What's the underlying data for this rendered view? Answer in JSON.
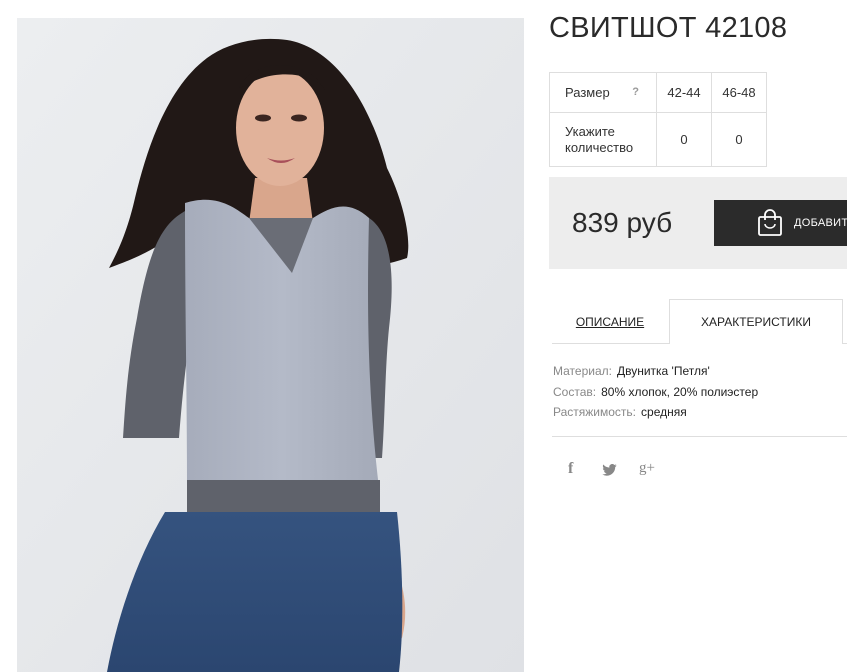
{
  "product": {
    "title": "СВИТШОТ 42108"
  },
  "size_table": {
    "size_label": "Размер",
    "help_mark": "?",
    "sizes": [
      "42-44",
      "46-48"
    ],
    "quantity_label": "Укажите количество",
    "quantities": [
      "0",
      "0"
    ]
  },
  "purchase": {
    "price": "839 руб",
    "add_button_label": "ДОБАВИТЬ В КОРЗИНУ"
  },
  "tabs": {
    "description": "ОПИСАНИЕ",
    "characteristics": "ХАРАКТЕРИСТИКИ",
    "active": "characteristics"
  },
  "specs": [
    {
      "key": "Материал:",
      "value": "Двунитка 'Петля'"
    },
    {
      "key": "Состав:",
      "value": "80% хлопок, 20% полиэстер"
    },
    {
      "key": "Растяжимость:",
      "value": "средняя"
    }
  ],
  "social": {
    "facebook": "f",
    "twitter": "twitter-icon",
    "googleplus": "g+"
  },
  "colors": {
    "button_bg": "#2b2b2b",
    "price_box_bg": "#ededed",
    "photo_bg": "#e4e5e8"
  }
}
